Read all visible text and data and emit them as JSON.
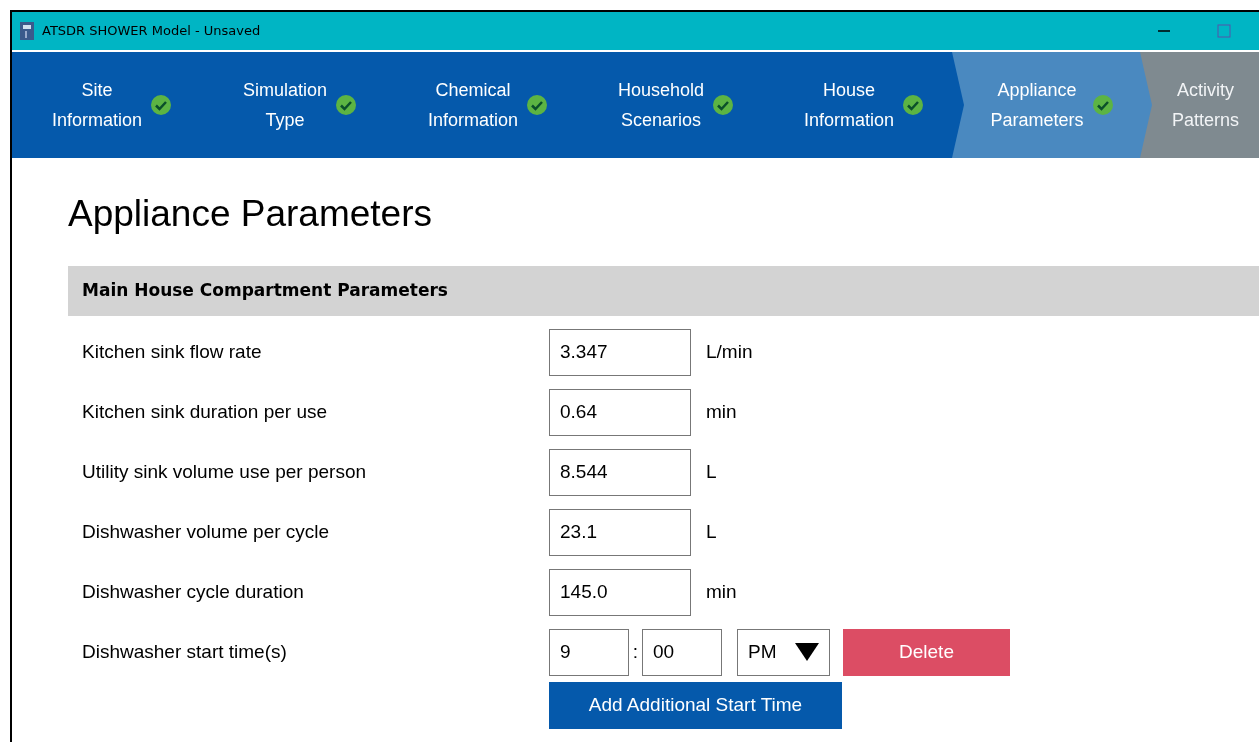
{
  "window": {
    "title": "ATSDR SHOWER Model - Unsaved"
  },
  "steps": [
    {
      "line1": "Site",
      "line2": "Information",
      "selected": false,
      "disabled": false,
      "checked": true
    },
    {
      "line1": "Simulation",
      "line2": "Type",
      "selected": false,
      "disabled": false,
      "checked": true
    },
    {
      "line1": "Chemical",
      "line2": "Information",
      "selected": false,
      "disabled": false,
      "checked": true
    },
    {
      "line1": "Household",
      "line2": "Scenarios",
      "selected": false,
      "disabled": false,
      "checked": true
    },
    {
      "line1": "House",
      "line2": "Information",
      "selected": false,
      "disabled": false,
      "checked": true
    },
    {
      "line1": "Appliance",
      "line2": "Parameters",
      "selected": true,
      "disabled": false,
      "checked": true
    },
    {
      "line1": "Activity",
      "line2": "Patterns",
      "selected": false,
      "disabled": true,
      "checked": false
    }
  ],
  "page_title": "Appliance Parameters",
  "section": {
    "title": "Main House Compartment Parameters",
    "rows": [
      {
        "label": "Kitchen sink flow rate",
        "value": "3.347",
        "unit": "L/min"
      },
      {
        "label": "Kitchen sink duration per use",
        "value": "0.64",
        "unit": "min"
      },
      {
        "label": "Utility sink volume use per person",
        "value": "8.544",
        "unit": "L"
      },
      {
        "label": "Dishwasher volume per cycle",
        "value": "23.1",
        "unit": "L"
      },
      {
        "label": "Dishwasher cycle duration",
        "value": "145.0",
        "unit": "min"
      }
    ],
    "start_time": {
      "label": "Dishwasher start time(s)",
      "hour": "9",
      "separator": ":",
      "minute": "00",
      "ampm": "PM",
      "delete_button": "Delete"
    },
    "add_button": "Add Additional Start Time"
  }
}
